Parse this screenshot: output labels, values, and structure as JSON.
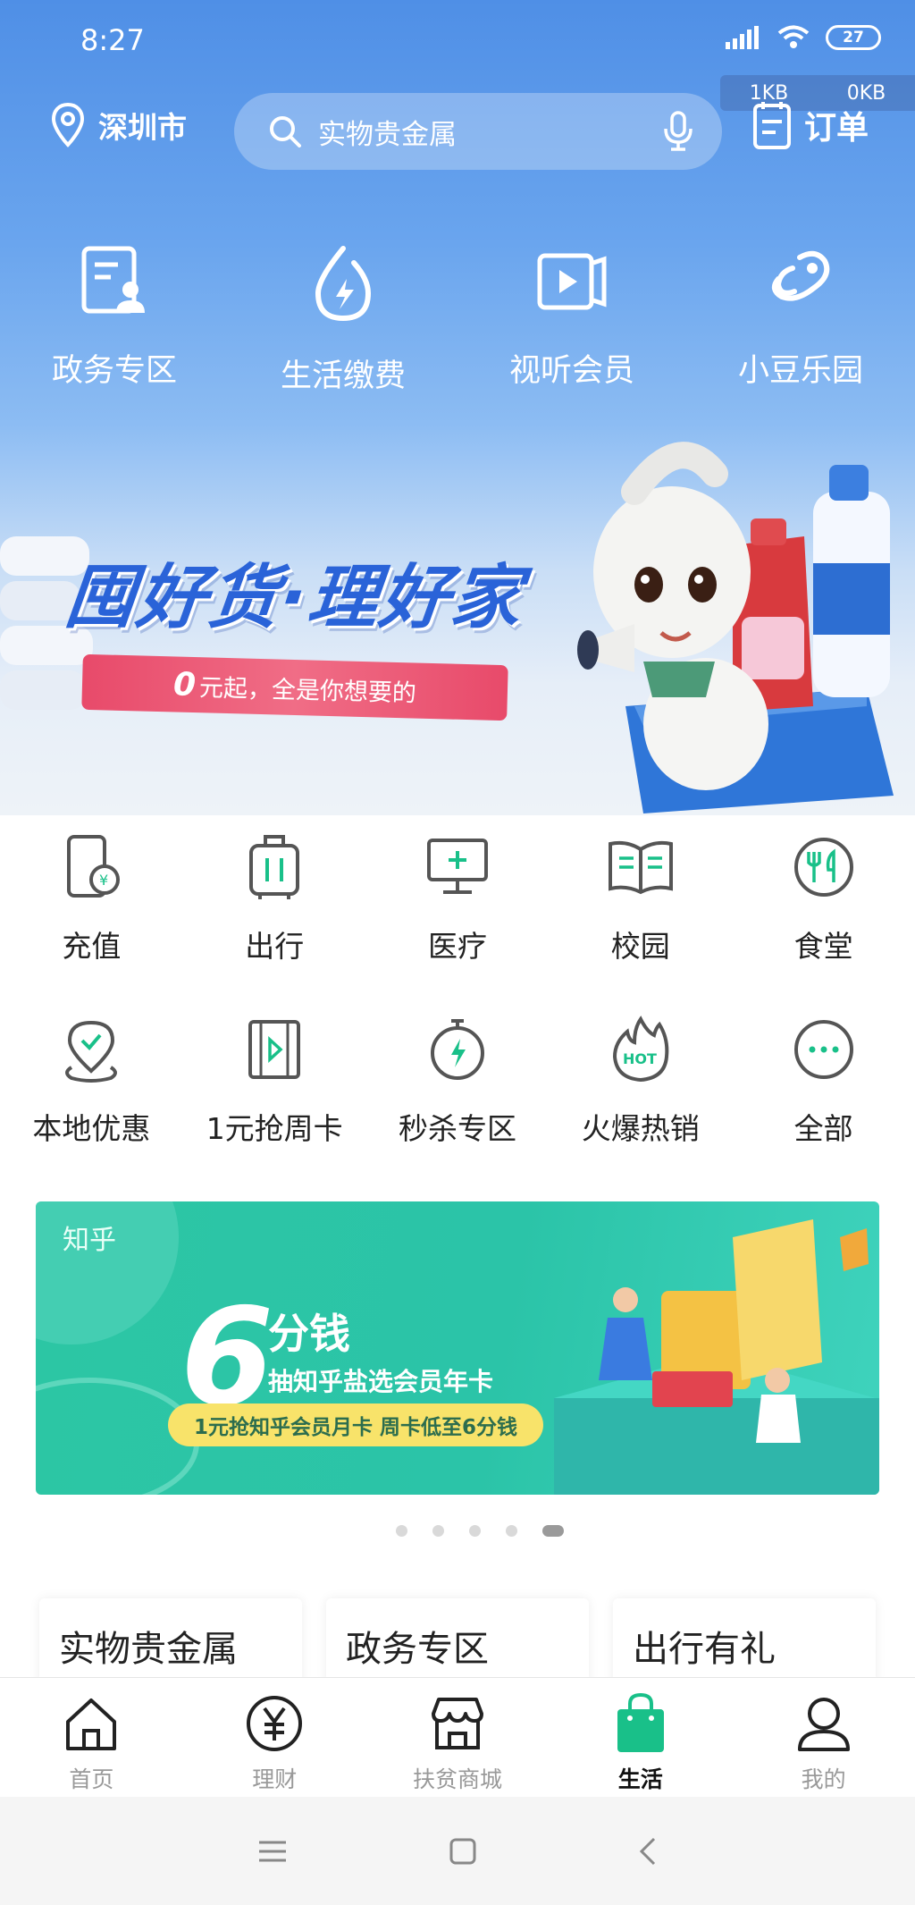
{
  "status_bar": {
    "time": "8:27",
    "battery": "27",
    "net_up": "1KB",
    "net_down": "0KB"
  },
  "header": {
    "city": "深圳市",
    "search_placeholder": "实物贵金属",
    "orders_label": "订单"
  },
  "hero_items": [
    {
      "label": "政务专区",
      "icon": "government-doc-icon"
    },
    {
      "label": "生活缴费",
      "icon": "water-drop-bolt-icon"
    },
    {
      "label": "视听会员",
      "icon": "video-icon"
    },
    {
      "label": "小豆乐园",
      "icon": "bean-icon"
    }
  ],
  "banner": {
    "title": "囤好货·理好家",
    "ribbon_num": "0",
    "ribbon_text": "元起，全是你想要的"
  },
  "services_row1": [
    {
      "label": "充值",
      "icon": "phone-recharge-icon"
    },
    {
      "label": "出行",
      "icon": "luggage-icon"
    },
    {
      "label": "医疗",
      "icon": "medical-monitor-icon"
    },
    {
      "label": "校园",
      "icon": "book-icon"
    },
    {
      "label": "食堂",
      "icon": "fork-knife-icon"
    }
  ],
  "services_row2": [
    {
      "label": "本地优惠",
      "icon": "location-check-icon"
    },
    {
      "label": "1元抢周卡",
      "icon": "film-play-icon"
    },
    {
      "label": "秒杀专区",
      "icon": "stopwatch-bolt-icon"
    },
    {
      "label": "火爆热销",
      "icon": "hot-flame-icon"
    },
    {
      "label": "全部",
      "icon": "more-icon"
    }
  ],
  "promo": {
    "brand": "知乎",
    "big": "6",
    "headline": "分钱",
    "sub": "抽知乎盐选会员年卡",
    "pill": "1元抢知乎会员月卡 周卡低至6分钱"
  },
  "carousel": {
    "count": 5,
    "active": 5
  },
  "cards": [
    {
      "label": "实物贵金属"
    },
    {
      "label": "政务专区"
    },
    {
      "label": "出行有礼"
    }
  ],
  "tabs": [
    {
      "label": "首页",
      "icon": "home-icon"
    },
    {
      "label": "理财",
      "icon": "yuan-icon"
    },
    {
      "label": "扶贫商城",
      "icon": "store-icon"
    },
    {
      "label": "生活",
      "icon": "shopping-bag-icon",
      "active": true
    },
    {
      "label": "我的",
      "icon": "user-icon"
    }
  ],
  "colors": {
    "accent": "#19c089",
    "hero_blue": "#4f8fe6",
    "icon_gray": "#555555"
  }
}
